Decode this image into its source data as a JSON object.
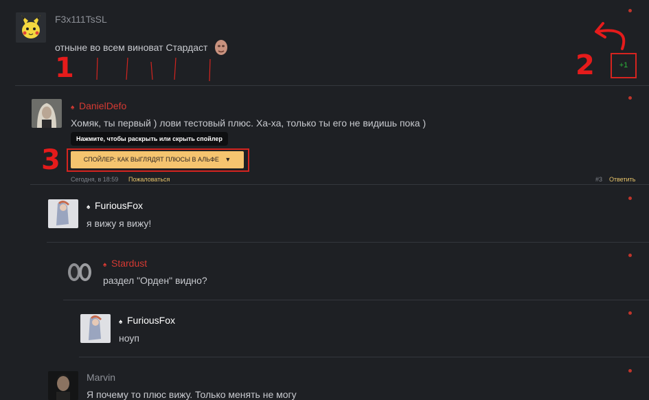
{
  "posts": {
    "main": {
      "author": "F3x111TsSL",
      "text": "отныне во всем виноват Стардаст",
      "plus_count": "+1"
    },
    "c1": {
      "author": "DanielDefo",
      "text": "Хомяк, ты первый ) лови тестовый плюс. Ха-ха, только ты его не видишь пока )",
      "tooltip": "Нажмите, чтобы раскрыть или скрыть спойлер",
      "spoiler_label": "СПОЙЛЕР: КАК ВЫГЛЯДЯТ ПЛЮСЫ В АЛЬФЕ",
      "time": "Сегодня, в 18:59",
      "report": "Пожаловаться",
      "number": "#3",
      "reply": "Ответить"
    },
    "c2": {
      "author": "FuriousFox",
      "text": "я вижу я вижу!"
    },
    "c3": {
      "author": "Stardust",
      "text": "раздел \"Орден\" видно?"
    },
    "c4": {
      "author": "FuriousFox",
      "text": "ноуп"
    },
    "c5": {
      "author": "Marvin",
      "text": "Я почему то плюс вижу. Только менять не могу"
    }
  },
  "annotations": {
    "n1": "1",
    "n2": "2",
    "n3": "3"
  },
  "colors": {
    "background": "#1e2024",
    "author_red": "#d63a33",
    "author_white": "#ffffff",
    "author_grey": "#8e9198",
    "plus_green": "#2db53c",
    "spoiler_bg": "#f5c46f",
    "annotation_red": "#e51b1b"
  }
}
